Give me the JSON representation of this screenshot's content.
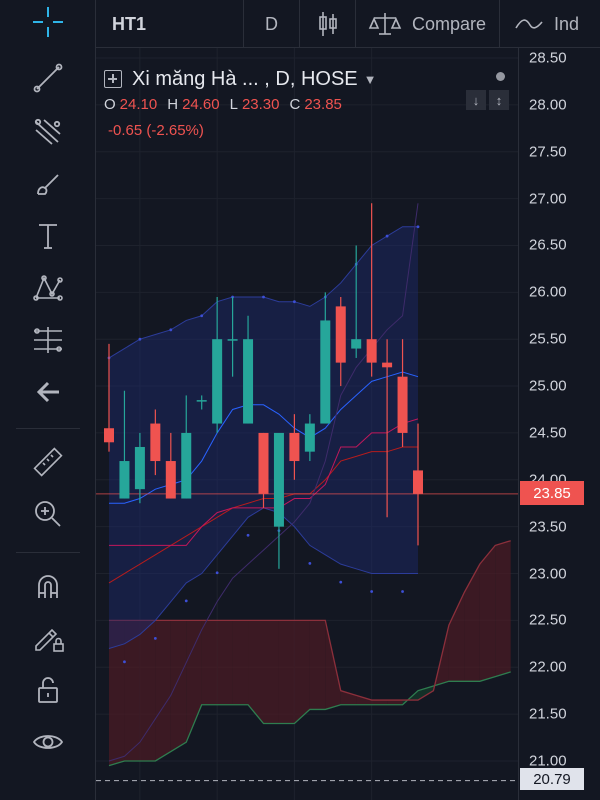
{
  "toolbar": {
    "symbol": "HT1",
    "interval": "D",
    "compare_label": "Compare",
    "indicators_label": "Ind"
  },
  "legend": {
    "title": "Xi măng Hà ... , D, HOSE",
    "o_key": "O",
    "o_val": "24.10",
    "h_key": "H",
    "h_val": "24.60",
    "l_key": "L",
    "l_val": "23.30",
    "c_key": "C",
    "c_val": "23.85",
    "change": "-0.65 (-2.65%)"
  },
  "price_axis": {
    "ticks": [
      "28.50",
      "28.00",
      "27.50",
      "27.00",
      "26.50",
      "26.00",
      "25.50",
      "25.00",
      "24.50",
      "24.00",
      "23.50",
      "23.00",
      "22.50",
      "22.00",
      "21.50",
      "21.00"
    ],
    "last_price": "23.85",
    "bottom_price": "20.79"
  },
  "colors": {
    "background": "#131722",
    "up": "#26a69a",
    "down": "#ef5350",
    "bb_fill": "#1c2a6e",
    "cloud_bear": "#4a1b24",
    "cloud_bull": "#163a2b"
  },
  "chart_data": {
    "type": "candlestick",
    "ylim": [
      20.79,
      28.5
    ],
    "x": [
      1,
      2,
      3,
      4,
      5,
      6,
      7,
      8,
      9,
      10,
      11,
      12,
      13,
      14,
      15,
      16,
      17,
      18,
      19,
      20,
      21
    ],
    "candles": [
      {
        "o": 24.55,
        "h": 25.45,
        "l": 24.3,
        "c": 24.4
      },
      {
        "o": 23.8,
        "h": 24.95,
        "l": 23.8,
        "c": 24.2
      },
      {
        "o": 23.9,
        "h": 24.5,
        "l": 23.75,
        "c": 24.35
      },
      {
        "o": 24.6,
        "h": 24.75,
        "l": 24.05,
        "c": 24.2
      },
      {
        "o": 24.2,
        "h": 24.5,
        "l": 23.8,
        "c": 23.8
      },
      {
        "o": 23.8,
        "h": 24.9,
        "l": 23.8,
        "c": 24.5
      },
      {
        "o": 24.85,
        "h": 24.9,
        "l": 24.75,
        "c": 24.85
      },
      {
        "o": 24.6,
        "h": 25.95,
        "l": 24.5,
        "c": 25.5
      },
      {
        "o": 25.5,
        "h": 25.95,
        "l": 25.1,
        "c": 25.5
      },
      {
        "o": 24.6,
        "h": 25.75,
        "l": 24.6,
        "c": 25.5
      },
      {
        "o": 24.5,
        "h": 24.5,
        "l": 23.7,
        "c": 23.85
      },
      {
        "o": 23.5,
        "h": 24.4,
        "l": 23.05,
        "c": 24.5
      },
      {
        "o": 24.5,
        "h": 24.7,
        "l": 24.0,
        "c": 24.2
      },
      {
        "o": 24.3,
        "h": 24.7,
        "l": 24.2,
        "c": 24.6
      },
      {
        "o": 24.6,
        "h": 26.0,
        "l": 24.6,
        "c": 25.7
      },
      {
        "o": 25.85,
        "h": 25.95,
        "l": 25.0,
        "c": 25.25
      },
      {
        "o": 25.4,
        "h": 26.5,
        "l": 25.3,
        "c": 25.5
      },
      {
        "o": 25.5,
        "h": 26.95,
        "l": 25.1,
        "c": 25.25
      },
      {
        "o": 25.25,
        "h": 25.5,
        "l": 23.6,
        "c": 25.2
      },
      {
        "o": 25.1,
        "h": 25.5,
        "l": 24.35,
        "c": 24.5
      },
      {
        "o": 24.1,
        "h": 24.6,
        "l": 23.3,
        "c": 23.85
      }
    ],
    "bb_upper": [
      25.3,
      25.4,
      25.5,
      25.55,
      25.6,
      25.7,
      25.75,
      25.9,
      25.95,
      25.95,
      25.95,
      25.9,
      25.9,
      25.85,
      25.95,
      26.1,
      26.3,
      26.5,
      26.6,
      26.7,
      26.7
    ],
    "bb_middle": [
      23.75,
      23.75,
      23.8,
      23.9,
      23.95,
      24.0,
      24.2,
      24.5,
      24.75,
      24.8,
      24.8,
      24.7,
      24.55,
      24.45,
      24.55,
      24.75,
      24.9,
      25.05,
      25.1,
      25.15,
      25.1
    ],
    "bb_lower": [
      22.2,
      22.25,
      22.35,
      22.5,
      22.7,
      22.9,
      23.0,
      23.2,
      23.4,
      23.6,
      23.7,
      23.65,
      23.5,
      23.3,
      23.2,
      23.1,
      23.05,
      23.0,
      23.0,
      23.0,
      23.0
    ],
    "tenkan": [
      23.3,
      23.3,
      23.3,
      23.3,
      23.3,
      23.3,
      23.5,
      23.65,
      23.7,
      23.7,
      23.7,
      23.7,
      23.8,
      23.8,
      23.95,
      24.35,
      24.35,
      24.5,
      24.5,
      24.6,
      24.65
    ],
    "kijun": [
      22.9,
      23.0,
      23.1,
      23.2,
      23.3,
      23.4,
      23.5,
      23.6,
      23.7,
      23.75,
      23.8,
      23.8,
      23.85,
      23.85,
      24.0,
      24.2,
      24.25,
      24.3,
      24.3,
      24.35,
      24.35
    ],
    "chikou": [
      21.0,
      21.05,
      21.2,
      21.45,
      21.7,
      22.05,
      22.4,
      22.7,
      22.95,
      23.1,
      23.25,
      23.4,
      23.55,
      23.75,
      24.2,
      24.9,
      25.2,
      25.4,
      25.6,
      25.75,
      26.95
    ],
    "span_a_x": [
      1,
      2,
      3,
      4,
      5,
      6,
      7,
      8,
      9,
      10,
      11,
      12,
      13,
      14,
      15,
      16,
      17,
      18,
      19,
      20,
      21,
      22,
      23,
      24,
      25,
      26,
      27
    ],
    "span_a": [
      20.95,
      21.0,
      21.0,
      21.0,
      21.1,
      21.2,
      21.6,
      21.6,
      21.6,
      21.6,
      21.4,
      21.4,
      21.4,
      21.55,
      21.55,
      21.6,
      21.6,
      21.6,
      21.6,
      21.6,
      21.75,
      21.8,
      21.85,
      21.85,
      21.85,
      21.9,
      21.95
    ],
    "span_b_x": [
      1,
      2,
      3,
      4,
      5,
      6,
      7,
      8,
      9,
      10,
      11,
      12,
      13,
      14,
      15,
      16,
      17,
      18,
      19,
      20,
      21,
      22,
      23,
      24,
      25,
      26,
      27
    ],
    "span_b": [
      22.5,
      22.5,
      22.5,
      22.5,
      22.5,
      22.5,
      22.5,
      22.5,
      22.5,
      22.5,
      22.5,
      22.5,
      22.5,
      22.5,
      22.5,
      21.75,
      21.7,
      21.65,
      21.65,
      21.65,
      21.65,
      21.75,
      22.45,
      22.8,
      23.1,
      23.3,
      23.35
    ]
  }
}
